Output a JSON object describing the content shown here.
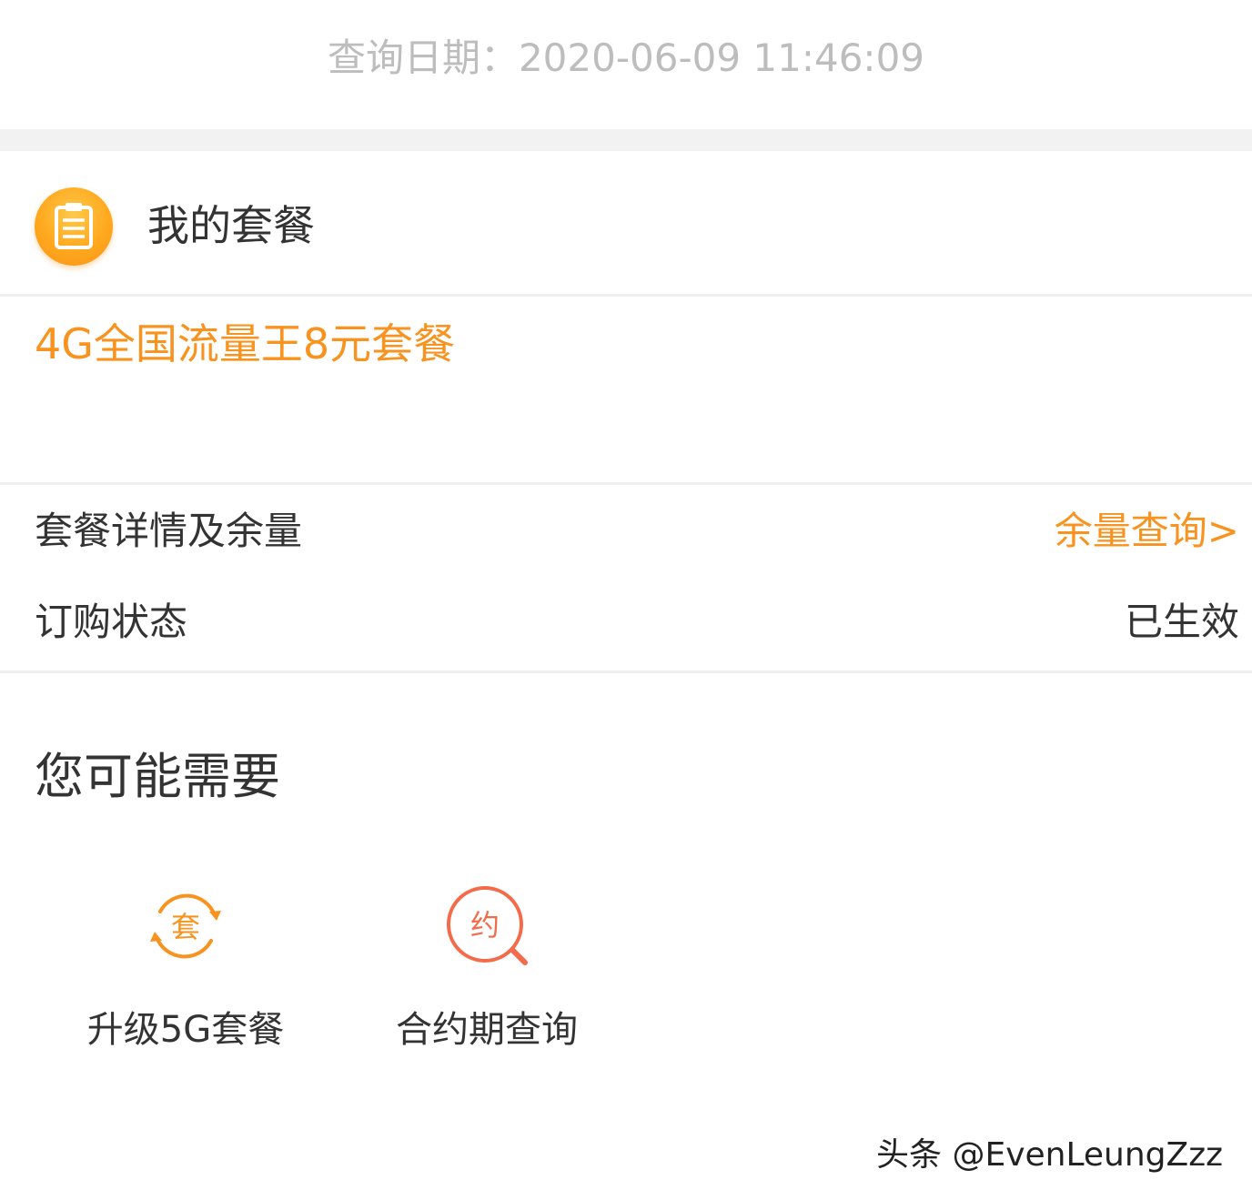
{
  "query_date": "查询日期：2020-06-09 11:46:09",
  "my_package": {
    "title": "我的套餐",
    "icon": "clipboard-icon",
    "package_name": "4G全国流量王8元套餐"
  },
  "details": {
    "balance_label": "套餐详情及余量",
    "balance_link": "余量查询>",
    "status_label": "订购状态",
    "status_value": "已生效"
  },
  "suggestions": {
    "title": "您可能需要",
    "items": [
      {
        "label": "升级5G套餐",
        "icon_text": "套",
        "icon": "upgrade-refresh-icon"
      },
      {
        "label": "合约期查询",
        "icon_text": "约",
        "icon": "contract-search-icon"
      }
    ]
  },
  "watermark": "头条 @EvenLeungZzz",
  "colors": {
    "accent": "#f7931e",
    "contract_icon": "#f26b4a",
    "text": "#333333",
    "muted": "#bdbdbd"
  }
}
